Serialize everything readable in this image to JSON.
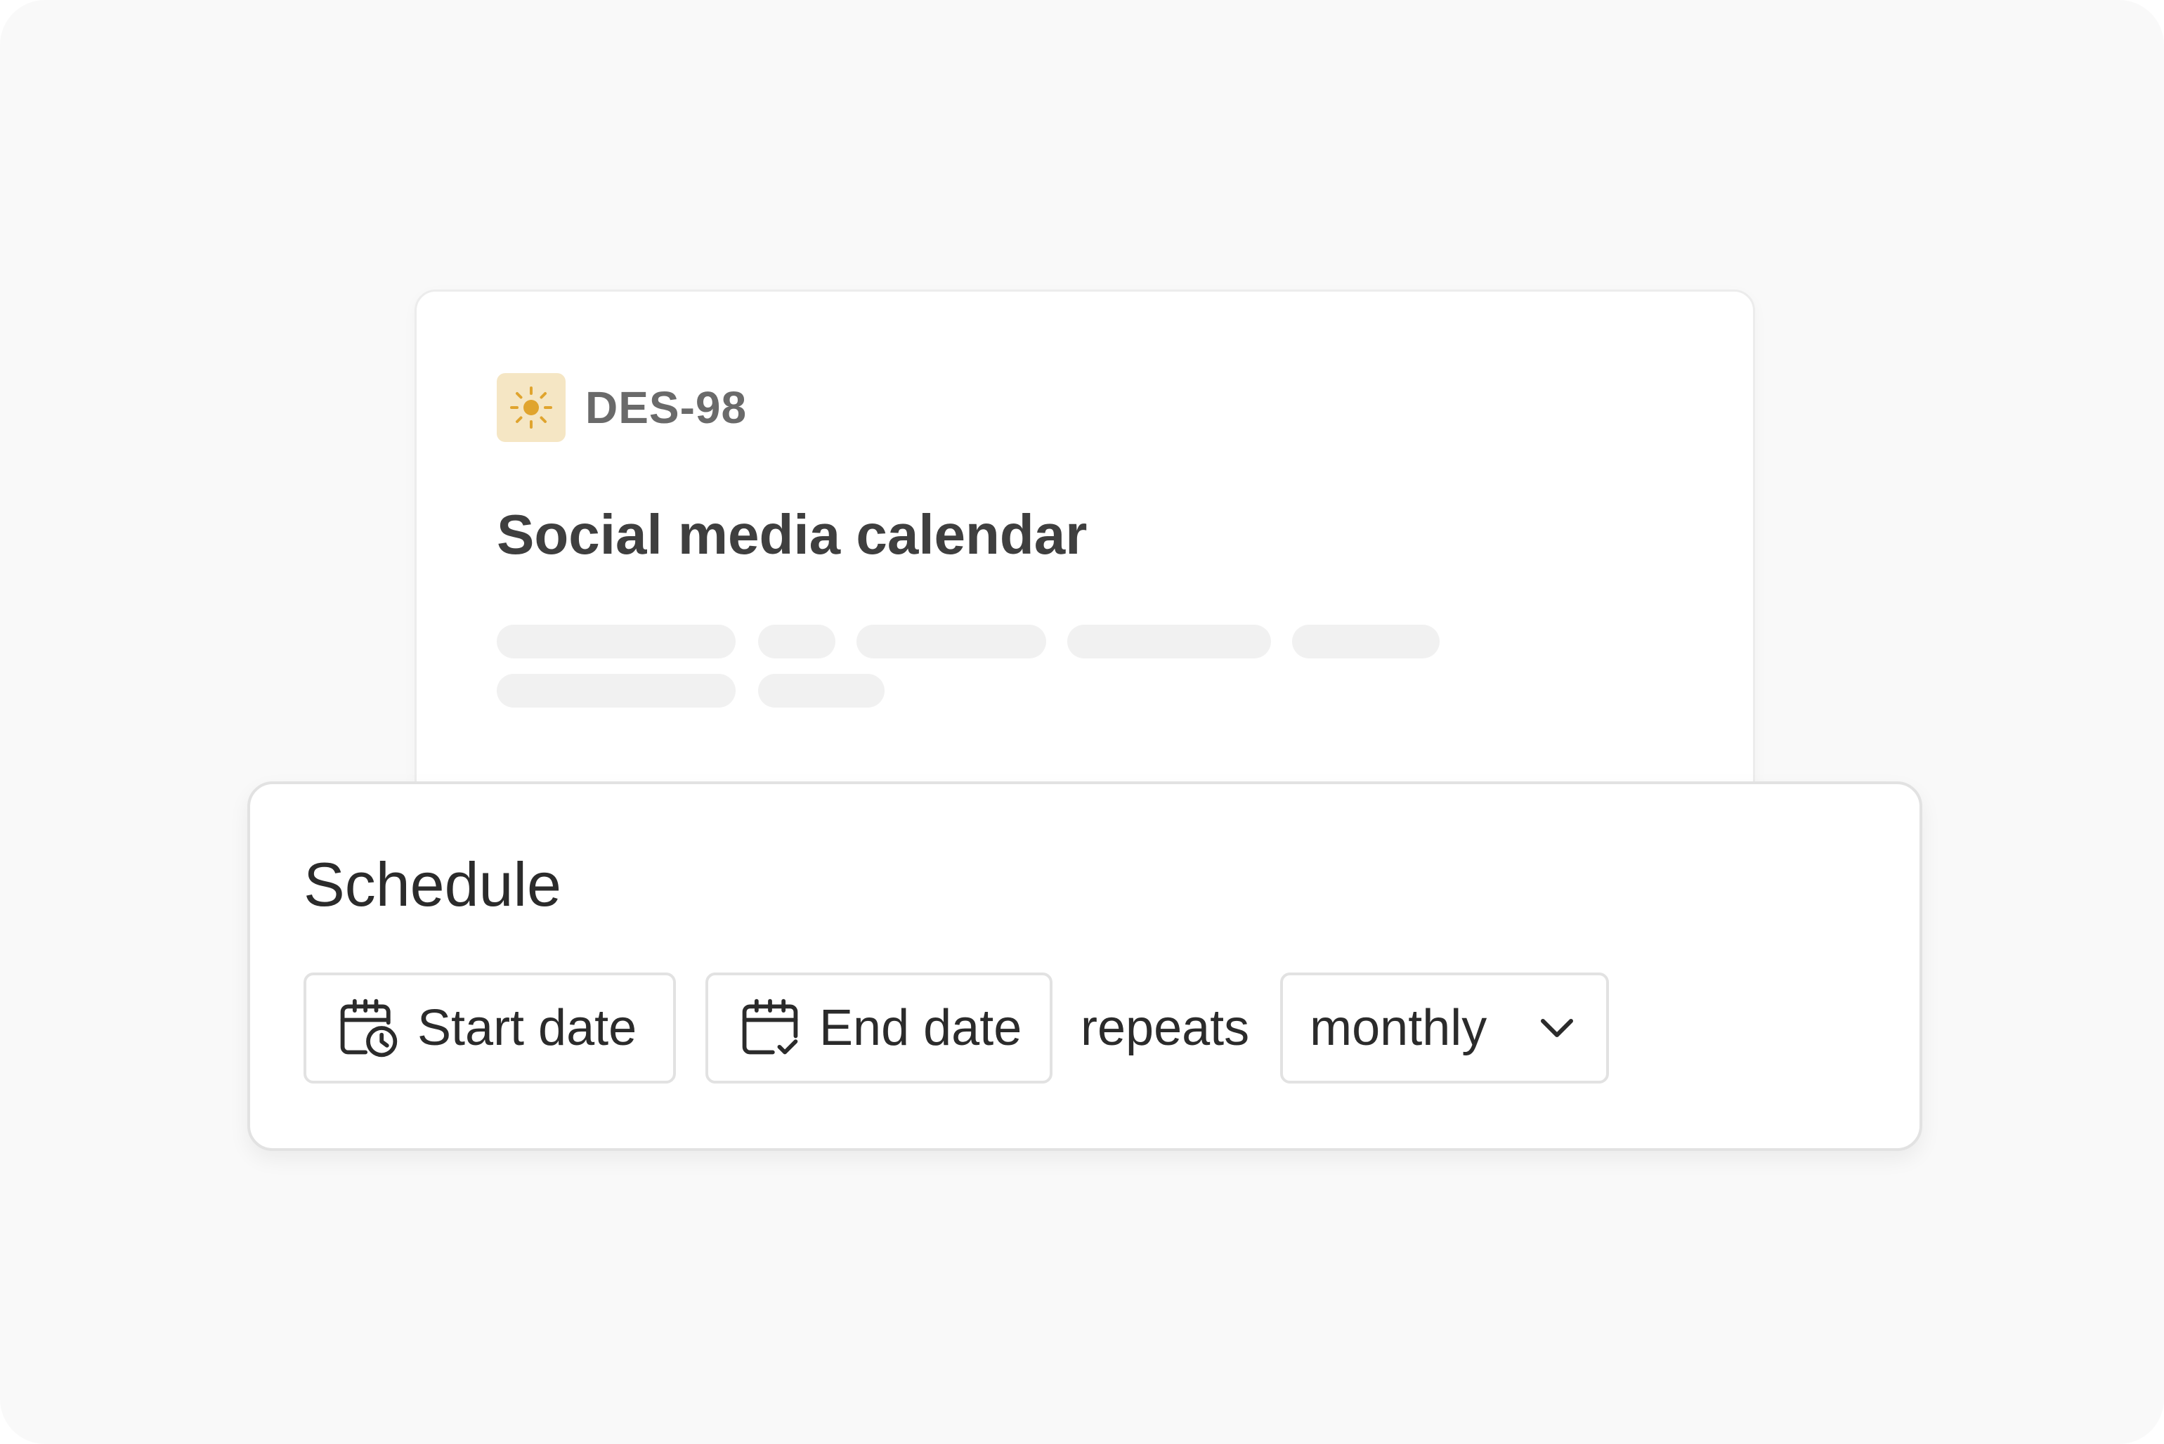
{
  "issue": {
    "id": "DES-98",
    "title": "Social media calendar",
    "icon": "sun-icon",
    "icon_bg": "#f5e6c4",
    "icon_color": "#e0a42e"
  },
  "schedule": {
    "title": "Schedule",
    "start_label": "Start date",
    "start_icon": "calendar-clock-icon",
    "end_label": "End date",
    "end_icon": "calendar-check-icon",
    "repeats_label": "repeats",
    "frequency_value": "monthly",
    "dropdown_icon": "chevron-down-icon"
  }
}
